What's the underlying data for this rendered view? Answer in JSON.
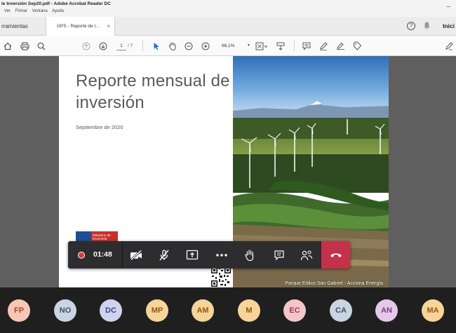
{
  "window": {
    "title": "le Inversión Sep20.pdf - Adobe Acrobat Reader DC",
    "menu": [
      "Ver",
      "Firmar",
      "Ventana",
      "Ayuda"
    ],
    "minimize_glyph": "–"
  },
  "tabs": {
    "tools_label": "rramientas",
    "doc_tab_label": "GPS - Reporte de l...",
    "doc_tab_close": "×",
    "help_glyph": "?",
    "signin_label": "Inici"
  },
  "toolbar": {
    "current_page": "1",
    "page_total": "/ 7",
    "zoom": "66,1%",
    "zoom_caret": "▾"
  },
  "document": {
    "title": "Reporte mensual de inversión",
    "date": "Septiembre de 2020",
    "logo_text": "Ministerio de Economía",
    "photo_caption": "Parque Eólico San Gabriel - Acciona Energía"
  },
  "meeting": {
    "timer": "01:48",
    "colors": {
      "bar": "#2d2c2e",
      "record": "#e0373c",
      "hangup": "#c4314b"
    },
    "controls": [
      "record-indicator",
      "camera-off-icon",
      "mic-off-icon",
      "share-screen-icon",
      "more-options-icon",
      "raise-hand-icon",
      "chat-icon",
      "participants-icon",
      "hang-up-icon"
    ]
  },
  "participants": [
    {
      "initials": "FP",
      "bg": "#f5c7b4",
      "fg": "#a6462c"
    },
    {
      "initials": "NO",
      "bg": "#c9d5e2",
      "fg": "#3d4f66"
    },
    {
      "initials": "DC",
      "bg": "#cfd3ee",
      "fg": "#3f4785"
    },
    {
      "initials": "MP",
      "bg": "#f7d49a",
      "fg": "#8a5a12"
    },
    {
      "initials": "AM",
      "bg": "#f7d49a",
      "fg": "#8a5a12"
    },
    {
      "initials": "M",
      "bg": "#f7d49a",
      "fg": "#8a5a12"
    },
    {
      "initials": "EC",
      "bg": "#f3c6c9",
      "fg": "#a43b45"
    },
    {
      "initials": "CA",
      "bg": "#c9d5e2",
      "fg": "#3d4f66"
    },
    {
      "initials": "AN",
      "bg": "#e6c8e8",
      "fg": "#7c3a85"
    },
    {
      "initials": "MA",
      "bg": "#f7d49a",
      "fg": "#8a5a12"
    }
  ]
}
